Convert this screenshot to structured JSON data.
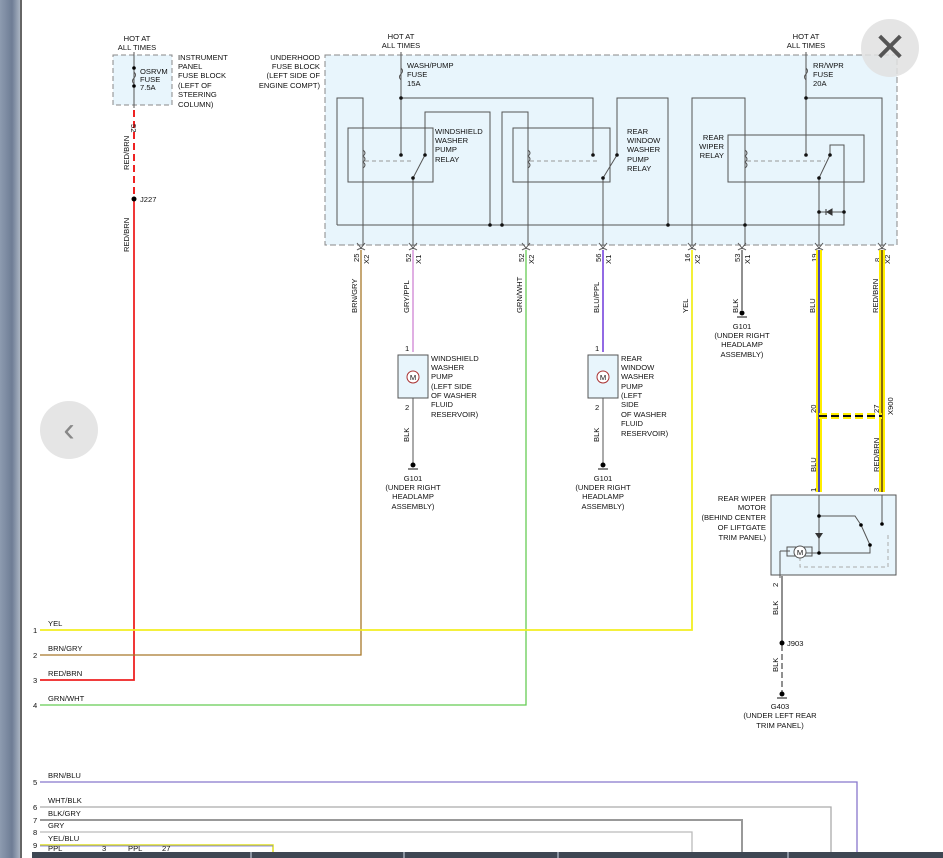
{
  "colors": {
    "red_brn": "#ee2222",
    "brn_gry": "#a8782a",
    "gry_ppl": "#dda6e0",
    "grn_wht": "#66cc55",
    "blu_ppl": "#7744dd",
    "yel": "#f2ee22",
    "blk": "#555555",
    "highlight": "#ffee00",
    "blu": "#2222dd",
    "brn": "#6b4a10",
    "box_fill": "#e8f5fc"
  },
  "controls": {
    "close_icon": "close-icon",
    "prev_icon": "chevron-left-icon",
    "close": "✕",
    "prev": "‹"
  },
  "ip_fuse": {
    "hot1": "HOT AT",
    "hot2": "ALL TIMES",
    "fuse": [
      "OSRVM",
      "FUSE",
      "7.5A"
    ],
    "block": [
      "INSTRUMENT",
      "PANEL",
      "FUSE BLOCK",
      "(LEFT OF",
      "STEERING",
      "COLUMN)"
    ],
    "pin": "52",
    "wire1": "RED/BRN",
    "splice": "J227",
    "wire2": "RED/BRN"
  },
  "underhood": {
    "label": [
      "UNDERHOOD",
      "FUSE BLOCK",
      "(LEFT SIDE OF",
      "ENGINE COMPT)"
    ],
    "wash_fuse": {
      "hot1": "HOT AT",
      "hot2": "ALL TIMES",
      "fuse": [
        "WASH/PUMP",
        "FUSE",
        "15A"
      ]
    },
    "wpr_fuse": {
      "hot1": "HOT AT",
      "hot2": "ALL TIMES",
      "fuse": [
        "RR/WPR",
        "FUSE",
        "20A"
      ]
    },
    "relays": [
      [
        "WINDSHIELD",
        "WASHER",
        "PUMP",
        "RELAY"
      ],
      [
        "REAR",
        "WINDOW",
        "WASHER",
        "PUMP",
        "RELAY"
      ],
      [
        "REAR",
        "WIPER",
        "RELAY"
      ]
    ]
  },
  "pins": [
    {
      "num": "25",
      "conn": "X2",
      "wire": "BRN/GRY"
    },
    {
      "num": "52",
      "conn": "X1",
      "wire": "GRY/PPL"
    },
    {
      "num": "52",
      "conn": "X2",
      "wire": "GRN/WHT"
    },
    {
      "num": "56",
      "conn": "X1",
      "wire": "BLU/PPL"
    },
    {
      "num": "16",
      "conn": "X2",
      "wire": "YEL"
    },
    {
      "num": "53",
      "conn": "X1",
      "wire": "BLK"
    },
    {
      "num": "19",
      "conn": "",
      "wire": "BLU"
    },
    {
      "num": "8",
      "conn": "X2",
      "wire": "RED/BRN"
    }
  ],
  "g101_top": {
    "name": "G101",
    "desc": [
      "(UNDER RIGHT",
      "HEADLAMP",
      "ASSEMBLY)"
    ]
  },
  "ws_pump": {
    "pin1": "1",
    "pin2": "2",
    "motor": "M",
    "label": [
      "WINDSHIELD",
      "WASHER",
      "PUMP",
      "(LEFT SIDE",
      "OF WASHER",
      "FLUID",
      "RESERVOIR)"
    ],
    "wire": "BLK",
    "ground": "G101",
    "gdesc": [
      "(UNDER RIGHT",
      "HEADLAMP",
      "ASSEMBLY)"
    ]
  },
  "rw_pump": {
    "pin1": "1",
    "pin2": "2",
    "motor": "M",
    "label": [
      "REAR",
      "WINDOW",
      "WASHER",
      "PUMP",
      "(LEFT",
      "SIDE",
      "OF WASHER",
      "FLUID",
      "RESERVOIR)"
    ],
    "wire": "BLK",
    "ground": "G101",
    "gdesc": [
      "(UNDER RIGHT",
      "HEADLAMP",
      "ASSEMBLY)"
    ]
  },
  "x900": {
    "pin_a": "20",
    "pin_b": "27",
    "conn": "X900",
    "wire_a": "BLU",
    "wire_b": "RED/BRN"
  },
  "motor": {
    "pin1": "1",
    "pin3": "3",
    "pin2": "2",
    "motor": "M",
    "label": [
      "REAR WIPER",
      "MOTOR",
      "(BEHIND CENTER",
      "OF LIFTGATE",
      "TRIM PANEL)"
    ],
    "wire1": "BLK",
    "splice": "J903",
    "wire2": "BLK",
    "ground": "G403",
    "gdesc": [
      "(UNDER LEFT REAR",
      "TRIM PANEL)"
    ]
  },
  "rows": [
    {
      "num": "1",
      "wire": "YEL"
    },
    {
      "num": "2",
      "wire": "BRN/GRY"
    },
    {
      "num": "3",
      "wire": "RED/BRN"
    },
    {
      "num": "4",
      "wire": "GRN/WHT"
    },
    {
      "num": "5",
      "wire": "BRN/BLU"
    },
    {
      "num": "6",
      "wire": "WHT/BLK"
    },
    {
      "num": "7",
      "wire": "BLK/GRY"
    },
    {
      "num": "8",
      "wire": "GRY"
    },
    {
      "num": "9",
      "wire": "YEL/BLU"
    }
  ],
  "row9_extra": [
    "PPL",
    "3",
    "PPL",
    "27"
  ]
}
